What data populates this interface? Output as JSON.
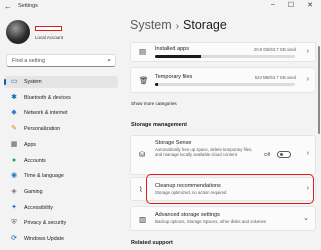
{
  "window": {
    "title": "Settings"
  },
  "titlebar_icons": {
    "back": "back-arrow-icon",
    "minimize": "minimize-icon",
    "maximize": "maximize-icon",
    "close": "close-icon"
  },
  "account": {
    "subtitle": "Local Account"
  },
  "search": {
    "placeholder": "Find a setting"
  },
  "sidebar": {
    "items": [
      {
        "label": "System",
        "icon": "system-icon",
        "active": true,
        "color": "#0067c0"
      },
      {
        "label": "Bluetooth & devices",
        "icon": "bluetooth-icon",
        "color": "#0067c0"
      },
      {
        "label": "Network & internet",
        "icon": "wifi-icon",
        "color": "#3a7bd5"
      },
      {
        "label": "Personalization",
        "icon": "brush-icon",
        "color": "#d9822b"
      },
      {
        "label": "Apps",
        "icon": "apps-icon",
        "color": "#555555"
      },
      {
        "label": "Accounts",
        "icon": "person-icon",
        "color": "#1aa15f"
      },
      {
        "label": "Time & language",
        "icon": "globe-icon",
        "color": "#1b6ec2"
      },
      {
        "label": "Gaming",
        "icon": "controller-icon",
        "color": "#777777"
      },
      {
        "label": "Accessibility",
        "icon": "accessibility-icon",
        "color": "#2a6bd1"
      },
      {
        "label": "Privacy & security",
        "icon": "shield-icon",
        "color": "#666666"
      },
      {
        "label": "Windows Update",
        "icon": "update-icon",
        "color": "#0067c0"
      }
    ]
  },
  "breadcrumb": {
    "parent": "System",
    "separator": "›",
    "current": "Storage"
  },
  "storage_items": [
    {
      "title": "Installed apps",
      "value": "20.8 GB/63.7 GB used",
      "fraction": 0.33,
      "icon": "installed-apps-icon"
    },
    {
      "title": "Temporary files",
      "value": "524 MB/63.7 GB used",
      "fraction": 0.01,
      "icon": "trash-icon"
    }
  ],
  "show_more": "Show more categories",
  "storage_management": {
    "heading": "Storage management",
    "sense": {
      "title": "Storage Sense",
      "description": "Automatically free up space, delete temporary files, and manage locally available cloud content",
      "toggle_label": "Off",
      "icon": "storage-sense-icon"
    },
    "cleanup": {
      "title": "Cleanup recommendations",
      "description": "Storage optimized, no action required",
      "icon": "broom-icon"
    },
    "advanced": {
      "title": "Advanced storage settings",
      "description": "Backup options, Storage Spaces, other disks and volumes",
      "icon": "advanced-storage-icon"
    }
  },
  "related_support": {
    "heading": "Related support"
  },
  "accent": {
    "highlight": "#e01919",
    "selection_bar": "#005fb8"
  }
}
